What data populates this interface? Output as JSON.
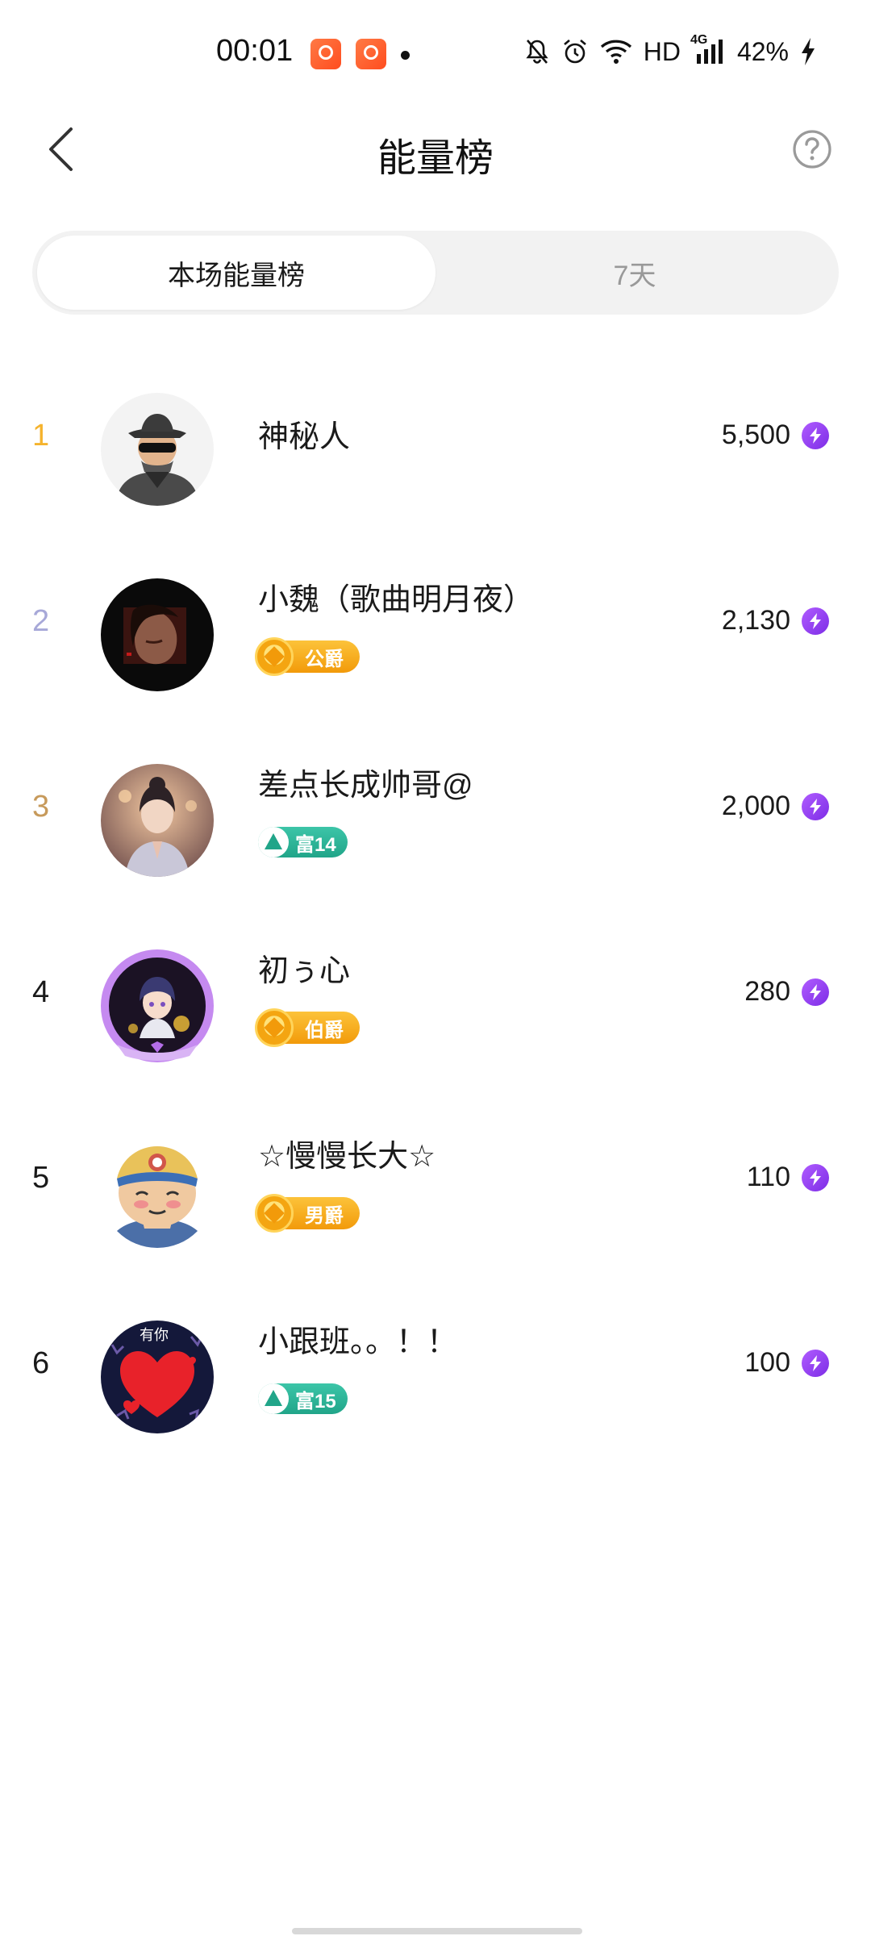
{
  "status_bar": {
    "time": "00:01",
    "network": "HD",
    "network_gen": "4G",
    "battery": "42%"
  },
  "header": {
    "title": "能量榜"
  },
  "tabs": [
    {
      "label": "本场能量榜",
      "active": true
    },
    {
      "label": "7天",
      "active": false
    }
  ],
  "ranking": [
    {
      "rank": "1",
      "rank_color": "#f5b32d",
      "name": "神秘人",
      "badge": null,
      "score": "5,500",
      "avatar": "mystery-person"
    },
    {
      "rank": "2",
      "rank_color": "#a7a8d8",
      "name": "小魏（歌曲明月夜）",
      "badge": {
        "type": "gold",
        "label": "公爵"
      },
      "score": "2,130",
      "avatar": "dark-portrait"
    },
    {
      "rank": "3",
      "rank_color": "#c79a5b",
      "name": "差点长成帅哥@",
      "badge": {
        "type": "green",
        "label": "富14"
      },
      "score": "2,000",
      "avatar": "girl-portrait"
    },
    {
      "rank": "4",
      "rank_color": "#1a1a1a",
      "name": "初ぅ心",
      "badge": {
        "type": "gold",
        "label": "伯爵"
      },
      "score": "280",
      "avatar": "anime-frame"
    },
    {
      "rank": "5",
      "rank_color": "#1a1a1a",
      "name": "☆慢慢长大☆",
      "badge": {
        "type": "gold",
        "label": "男爵"
      },
      "score": "110",
      "avatar": "cartoon-boy"
    },
    {
      "rank": "6",
      "rank_color": "#1a1a1a",
      "name": "小跟班。。！！",
      "badge": {
        "type": "green",
        "label": "富15"
      },
      "score": "100",
      "avatar": "heart",
      "avatar_text": "有你"
    }
  ],
  "colors": {
    "energy_accent": "#8a3cf0",
    "gold_badge": "#f5a613",
    "green_badge": "#27b293"
  }
}
